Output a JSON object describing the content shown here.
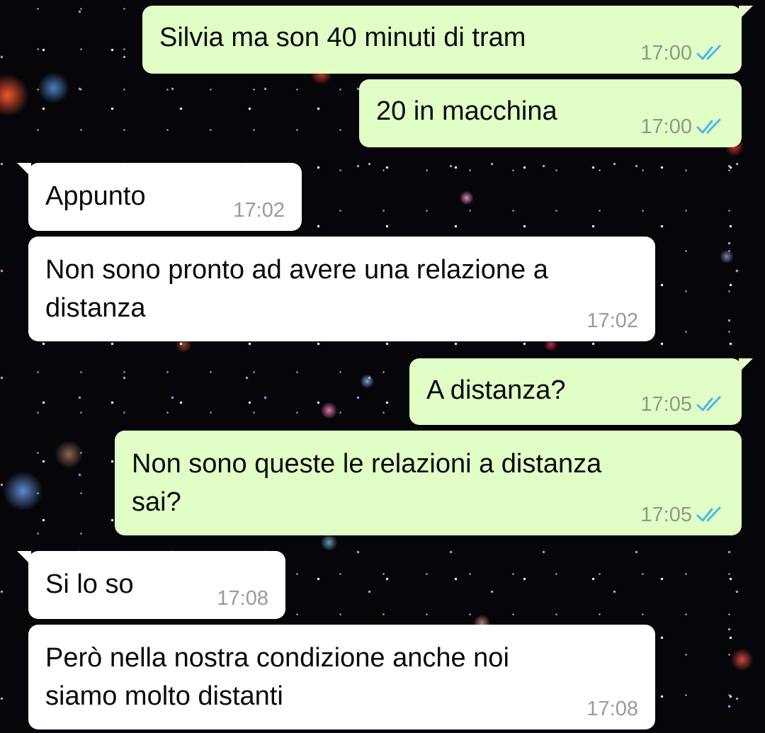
{
  "theme": {
    "outgoing_bubble_color": "#e1fec6",
    "incoming_bubble_color": "#ffffff",
    "read_tick_color": "#4fb5ec",
    "wallpaper": "deep space starfield"
  },
  "messages": [
    {
      "direction": "outgoing",
      "text": "Silvia ma son 40 minuti di tram",
      "time": "17:00",
      "status_icon": "double-check-read-icon"
    },
    {
      "direction": "outgoing",
      "text": "20 in macchina",
      "time": "17:00",
      "status_icon": "double-check-read-icon"
    },
    {
      "direction": "incoming",
      "text": "Appunto",
      "time": "17:02"
    },
    {
      "direction": "incoming",
      "text": "Non sono pronto ad avere una relazione a\ndistanza",
      "time": "17:02"
    },
    {
      "direction": "outgoing",
      "text": "A distanza?",
      "time": "17:05",
      "status_icon": "double-check-read-icon"
    },
    {
      "direction": "outgoing",
      "text": "Non sono queste le relazioni a distanza\nsai?",
      "time": "17:05",
      "status_icon": "double-check-read-icon"
    },
    {
      "direction": "incoming",
      "text": "Si lo so",
      "time": "17:08"
    },
    {
      "direction": "incoming",
      "text": "Però nella nostra condizione anche noi\nsiamo molto distanti",
      "time": "17:08"
    }
  ]
}
